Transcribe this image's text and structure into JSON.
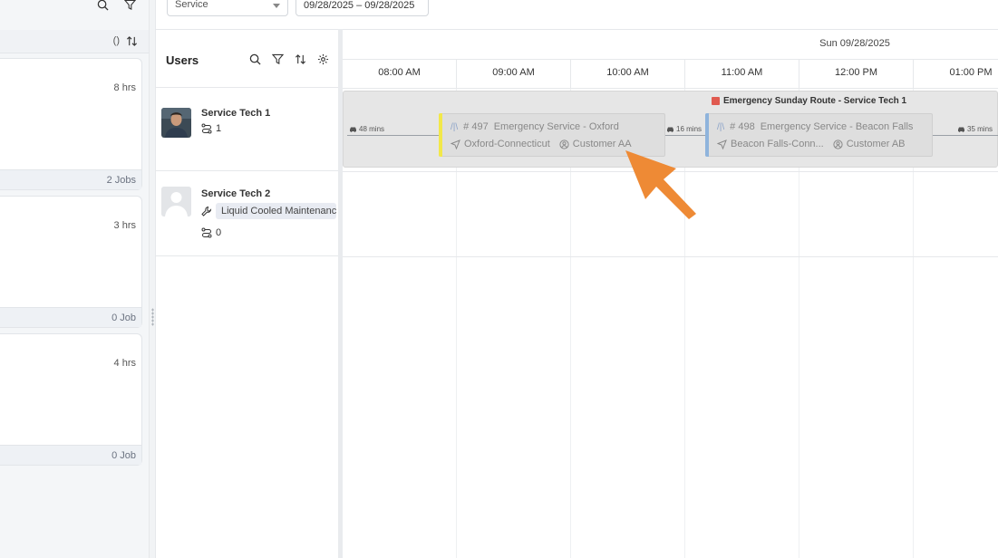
{
  "filters": {
    "service_select": "Service",
    "date_range": "09/28/2025 – 09/28/2025"
  },
  "left_panel": {
    "sort_label": "()",
    "cards": [
      {
        "hours": "8 hrs",
        "jobs": "2 Jobs"
      },
      {
        "hours": "3 hrs",
        "jobs": "0 Job"
      },
      {
        "hours": "4 hrs",
        "jobs": "0 Job"
      }
    ]
  },
  "users_panel": {
    "title": "Users",
    "users": [
      {
        "name": "Service Tech 1",
        "route_count": "1"
      },
      {
        "name": "Service Tech 2",
        "skill": "Liquid Cooled Maintenance",
        "route_count": "0"
      }
    ]
  },
  "timeline": {
    "day": "Sun 09/28/2025",
    "hours": [
      "08:00 AM",
      "09:00 AM",
      "10:00 AM",
      "11:00 AM",
      "12:00 PM",
      "01:00 PM"
    ],
    "route": {
      "title": "Emergency Sunday Route - Service Tech 1",
      "color": "#e05a50",
      "travel": [
        "48 mins",
        "16 mins",
        "35 mins"
      ],
      "jobs": [
        {
          "type_icon": "/|\\",
          "number": "# 497",
          "title": "Emergency Service - Oxford",
          "location": "Oxford-Connecticut",
          "customer": "Customer AA",
          "accent": "#f2e84a"
        },
        {
          "type_icon": "/|\\",
          "number": "# 498",
          "title": "Emergency Service - Beacon Falls",
          "location": "Beacon Falls-Conn...",
          "customer": "Customer AB",
          "accent": "#8fb4dc"
        }
      ]
    }
  },
  "colors": {
    "cursor": "#ee8a35"
  }
}
